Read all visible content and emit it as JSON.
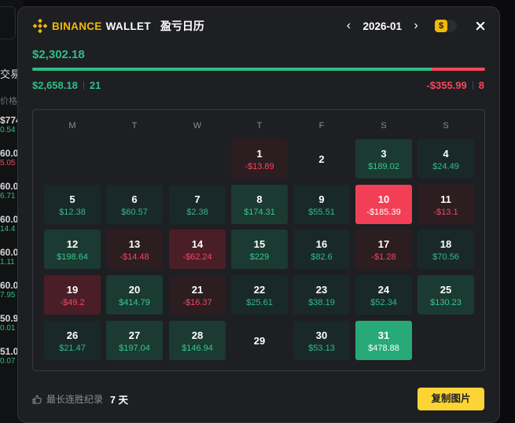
{
  "app": {
    "brand": "BINANCE",
    "brand_suffix": "WALLET",
    "title": "盈亏日历",
    "month": "2026-01",
    "prev_icon": "chevron-left-icon",
    "next_icon": "chevron-right-icon",
    "toggle_symbol": "$",
    "close_icon": "close-icon"
  },
  "summary": {
    "total": "$2,302.18",
    "profit": "$2,658.18",
    "win_days": "21",
    "loss": "-$355.99",
    "loss_days": "8",
    "win_ratio": 0.882
  },
  "calendar": {
    "weekdays": [
      "M",
      "T",
      "W",
      "T",
      "F",
      "S",
      "S"
    ],
    "days": [
      {
        "day": "1",
        "value": "-$13.89",
        "tone": "r1"
      },
      {
        "day": "2",
        "value": "",
        "tone": "empty"
      },
      {
        "day": "3",
        "value": "$189.02",
        "tone": "g2"
      },
      {
        "day": "4",
        "value": "$24.49",
        "tone": "g1"
      },
      {
        "day": "5",
        "value": "$12.38",
        "tone": "g1"
      },
      {
        "day": "6",
        "value": "$60.57",
        "tone": "g1"
      },
      {
        "day": "7",
        "value": "$2.38",
        "tone": "g1"
      },
      {
        "day": "8",
        "value": "$174.31",
        "tone": "g2"
      },
      {
        "day": "9",
        "value": "$55.51",
        "tone": "g1"
      },
      {
        "day": "10",
        "value": "-$185.39",
        "tone": "r3"
      },
      {
        "day": "11",
        "value": "-$13.1",
        "tone": "r1"
      },
      {
        "day": "12",
        "value": "$198.64",
        "tone": "g2"
      },
      {
        "day": "13",
        "value": "-$14.48",
        "tone": "r1"
      },
      {
        "day": "14",
        "value": "-$62.24",
        "tone": "r2"
      },
      {
        "day": "15",
        "value": "$229",
        "tone": "g2"
      },
      {
        "day": "16",
        "value": "$82.6",
        "tone": "g1"
      },
      {
        "day": "17",
        "value": "-$1.28",
        "tone": "r1"
      },
      {
        "day": "18",
        "value": "$70.56",
        "tone": "g1"
      },
      {
        "day": "19",
        "value": "-$49.2",
        "tone": "r2"
      },
      {
        "day": "20",
        "value": "$414.79",
        "tone": "g2"
      },
      {
        "day": "21",
        "value": "-$16.37",
        "tone": "r1"
      },
      {
        "day": "22",
        "value": "$25.61",
        "tone": "g1"
      },
      {
        "day": "23",
        "value": "$38.19",
        "tone": "g1"
      },
      {
        "day": "24",
        "value": "$52.34",
        "tone": "g1"
      },
      {
        "day": "25",
        "value": "$130.23",
        "tone": "g2"
      },
      {
        "day": "26",
        "value": "$21.47",
        "tone": "g1"
      },
      {
        "day": "27",
        "value": "$197.04",
        "tone": "g2"
      },
      {
        "day": "28",
        "value": "$146.94",
        "tone": "g2"
      },
      {
        "day": "29",
        "value": "",
        "tone": "empty"
      },
      {
        "day": "30",
        "value": "$53.13",
        "tone": "g1"
      },
      {
        "day": "31",
        "value": "$478.88",
        "tone": "g3"
      }
    ]
  },
  "footer": {
    "streak_icon": "thumbs-up-icon",
    "streak_label": "最长连胜纪录",
    "streak_value": "7 天",
    "copy_label": "复制图片"
  },
  "background": {
    "label": "交易",
    "col_label": "价格",
    "rows": [
      {
        "a": "$774",
        "b": "0.54",
        "c": "#2ebd85"
      },
      {
        "a": "60.0",
        "b": "5.05",
        "c": "#f6465d"
      },
      {
        "a": "60.0",
        "b": "6.71",
        "c": "#2ebd85"
      },
      {
        "a": "60.0",
        "b": "14.4",
        "c": "#2ebd85"
      },
      {
        "a": "60.0",
        "b": "1.11",
        "c": "#2ebd85"
      },
      {
        "a": "60.0",
        "b": "7.95",
        "c": "#2ebd85"
      },
      {
        "a": "50.9",
        "b": "0.01",
        "c": "#2ebd85"
      },
      {
        "a": "51.0",
        "b": "0.07",
        "c": "#2ebd85"
      }
    ]
  },
  "colors": {
    "accent": "#f0b90b",
    "profit": "#2ebd85",
    "loss": "#f6465d",
    "button": "#fcd535"
  }
}
